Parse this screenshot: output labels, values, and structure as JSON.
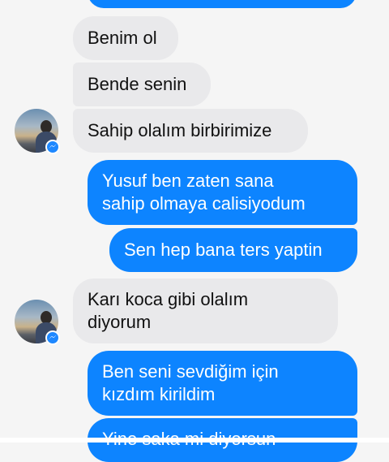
{
  "conversation": {
    "messages": [
      {
        "direction": "outgoing",
        "text": ""
      },
      {
        "direction": "incoming",
        "text": "Benim ol"
      },
      {
        "direction": "incoming",
        "text": "Bende senin"
      },
      {
        "direction": "incoming",
        "text": "Sahip olalım birbirimize"
      },
      {
        "direction": "outgoing",
        "text": "Yusuf ben zaten sana\nsahip olmaya calisiyodum"
      },
      {
        "direction": "outgoing",
        "text": "Sen hep bana ters yaptin"
      },
      {
        "direction": "incoming",
        "text": "Karı koca gibi olalım\ndiyorum"
      },
      {
        "direction": "outgoing",
        "text": "Ben seni sevdiğim için\nkızdım kirildim"
      },
      {
        "direction": "outgoing",
        "text": "Yine saka mi diyorsun"
      }
    ]
  },
  "icons": {
    "avatar_badge": "messenger-icon"
  },
  "colors": {
    "background": "#f5f5f5",
    "incoming_bubble": "#e9e9eb",
    "outgoing_bubble": "#0d84ff",
    "badge": "#1e88ff"
  }
}
